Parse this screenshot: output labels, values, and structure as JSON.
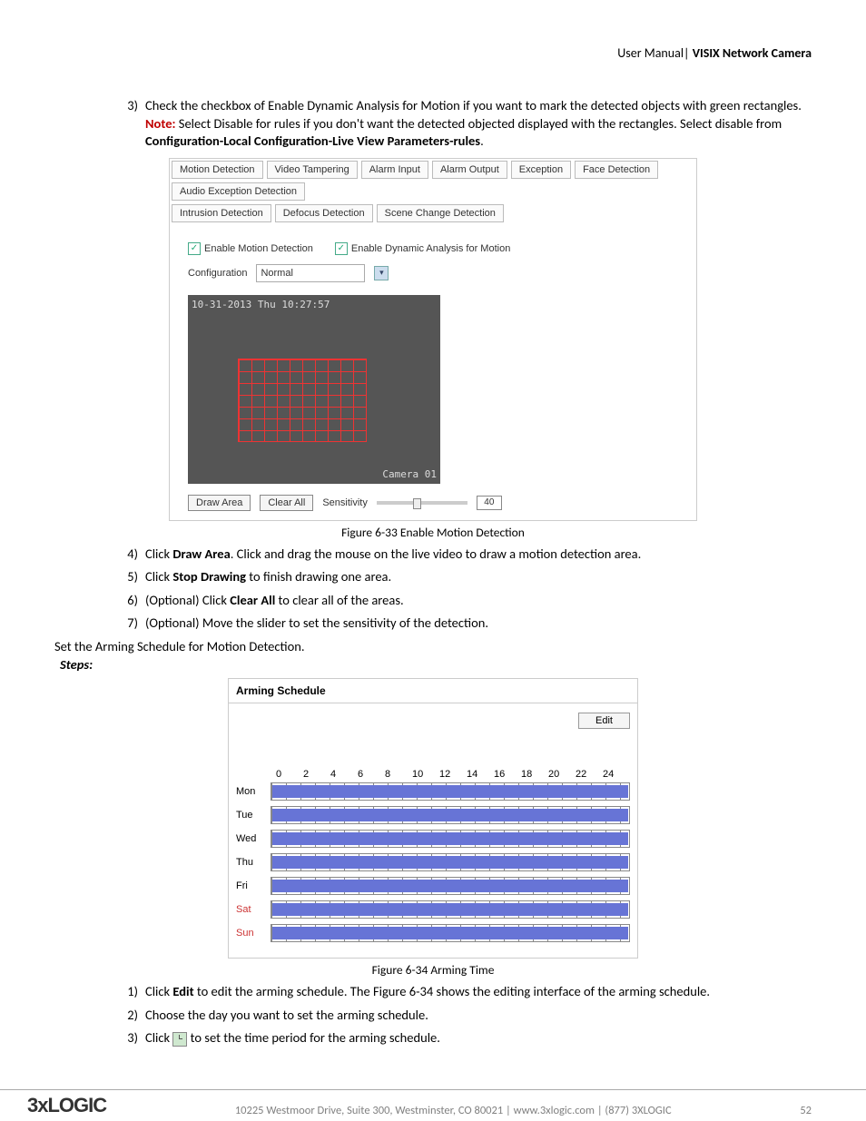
{
  "header": {
    "left": "User Manual|",
    "right": "VISIX Network Camera"
  },
  "step3": {
    "num": "3)",
    "text1": "Check the checkbox of Enable Dynamic Analysis for Motion if you want to mark the detected objects with green rectangles.",
    "noteLabel": "Note:",
    "noteText": " Select Disable for rules if you don't want the detected objected displayed with the rectangles. Select disable from ",
    "noteBold": "Configuration-Local Configuration-Live View Parameters-rules",
    "noteEnd": "."
  },
  "tabs1": [
    "Motion Detection",
    "Video Tampering",
    "Alarm Input",
    "Alarm Output",
    "Exception",
    "Face Detection",
    "Audio Exception Detection"
  ],
  "tabs2": [
    "Intrusion Detection",
    "Defocus Detection",
    "Scene Change Detection"
  ],
  "chk1": "Enable Motion Detection",
  "chk2": "Enable Dynamic Analysis for Motion",
  "cfgLabel": "Configuration",
  "cfgValue": "Normal",
  "timestamp": "10-31-2013 Thu 10:27:57",
  "camera": "Camera 01",
  "drawArea": "Draw Area",
  "clearAll": "Clear All",
  "sensLabel": "Sensitivity",
  "sensVal": "40",
  "fig1": "Figure 6-33 Enable Motion Detection",
  "step4": {
    "num": "4)",
    "pre": "Click ",
    "b": "Draw Area",
    "post": ". Click and drag the mouse on the live video to draw a motion detection area."
  },
  "step5": {
    "num": "5)",
    "pre": "Click ",
    "b": "Stop Drawing",
    "post": " to finish drawing one area."
  },
  "step6": {
    "num": "6)",
    "pre": "(Optional) Click ",
    "b": "Clear All",
    "post": " to clear all of the areas."
  },
  "step7": {
    "num": "7)",
    "text": "(Optional) Move the slider to set the sensitivity of the detection."
  },
  "sectionHdr": "Set the Arming Schedule for Motion Detection.",
  "stepsLabel": "Steps:",
  "armTitle": "Arming Schedule",
  "editBtn": "Edit",
  "hours": [
    "0",
    "2",
    "4",
    "6",
    "8",
    "10",
    "12",
    "14",
    "16",
    "18",
    "20",
    "22",
    "24"
  ],
  "days": [
    {
      "label": "Mon",
      "red": false
    },
    {
      "label": "Tue",
      "red": false
    },
    {
      "label": "Wed",
      "red": false
    },
    {
      "label": "Thu",
      "red": false
    },
    {
      "label": "Fri",
      "red": false
    },
    {
      "label": "Sat",
      "red": true
    },
    {
      "label": "Sun",
      "red": true
    }
  ],
  "fig2": "Figure 6-34 Arming Time",
  "arm1": {
    "num": "1)",
    "pre": "Click ",
    "b": "Edit",
    "post": " to edit the arming schedule. The Figure 6-34 shows the editing interface of the arming schedule."
  },
  "arm2": {
    "num": "2)",
    "text": "Choose the day you want to set the arming schedule."
  },
  "arm3": {
    "num": "3)",
    "pre": "Click ",
    "post": " to set the time period for the arming schedule."
  },
  "footer": {
    "logo": "3xLOGIC",
    "addr": "10225 Westmoor Drive, Suite 300, Westminster, CO 80021 | www.3xlogic.com | (877) 3XLOGIC",
    "page": "52"
  }
}
